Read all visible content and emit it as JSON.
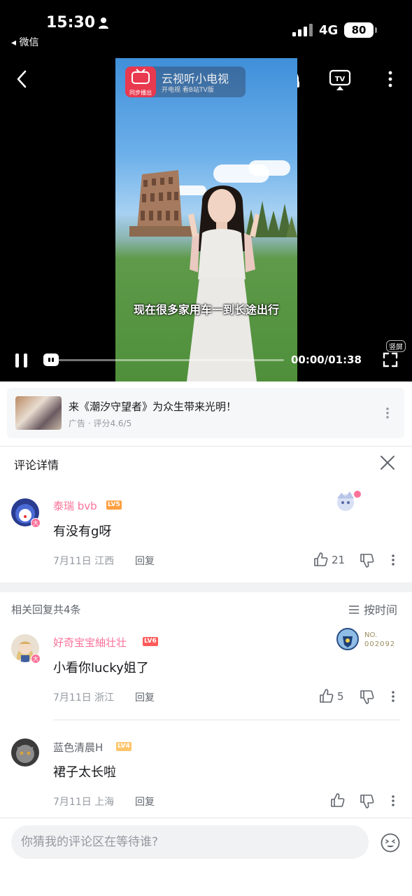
{
  "status_bar": {
    "time": "15:30",
    "back_app": "◂ 微信",
    "network": "4G",
    "battery": "80"
  },
  "video": {
    "watermark_title": "云视听小电视",
    "watermark_sub": "开电视 看B站TV版",
    "watermark_badge": "同步播出",
    "listen_label": "听",
    "tv_label": "TV",
    "subtitle": "现在很多家用车一到长途出行",
    "progress_fraction": 0.0,
    "time_readout": "00:00/01:38",
    "vertical_label": "竖屏"
  },
  "ad": {
    "title": "来《潮汐守望者》为众生带来光明！",
    "meta": "广告 · 评分4.6/5"
  },
  "comment_section": {
    "title": "评论详情"
  },
  "main_comment": {
    "username": "泰瑞 bvb",
    "level": "LV5",
    "text": "有没有g呀",
    "date": "7月11日  江西",
    "reply_label": "回复",
    "likes": "21",
    "avatar_badge": "大"
  },
  "replies_header": {
    "count_text": "相关回复共4条",
    "sort_label": "按时间"
  },
  "replies": [
    {
      "username": "好奇宝宝紬壮壮",
      "level": "LV6",
      "text": "小看你lucky姐了",
      "date": "7月11日  浙江",
      "reply_label": "回复",
      "likes": "5",
      "avatar_badge": "大",
      "fan_badge_no": "NO.",
      "fan_badge_num": "002092"
    },
    {
      "username": "蓝色清晨H",
      "level": "LV4",
      "text": "裙子太长啦",
      "date": "7月11日  上海",
      "reply_label": "回复",
      "likes": ""
    }
  ],
  "input": {
    "placeholder": "你猜我的评论区在等待谁?"
  },
  "colors": {
    "brand_pink": "#fb7299",
    "lv5": "#ff9f40",
    "lv6": "#ff5a5a",
    "lv4": "#ffc56a"
  }
}
